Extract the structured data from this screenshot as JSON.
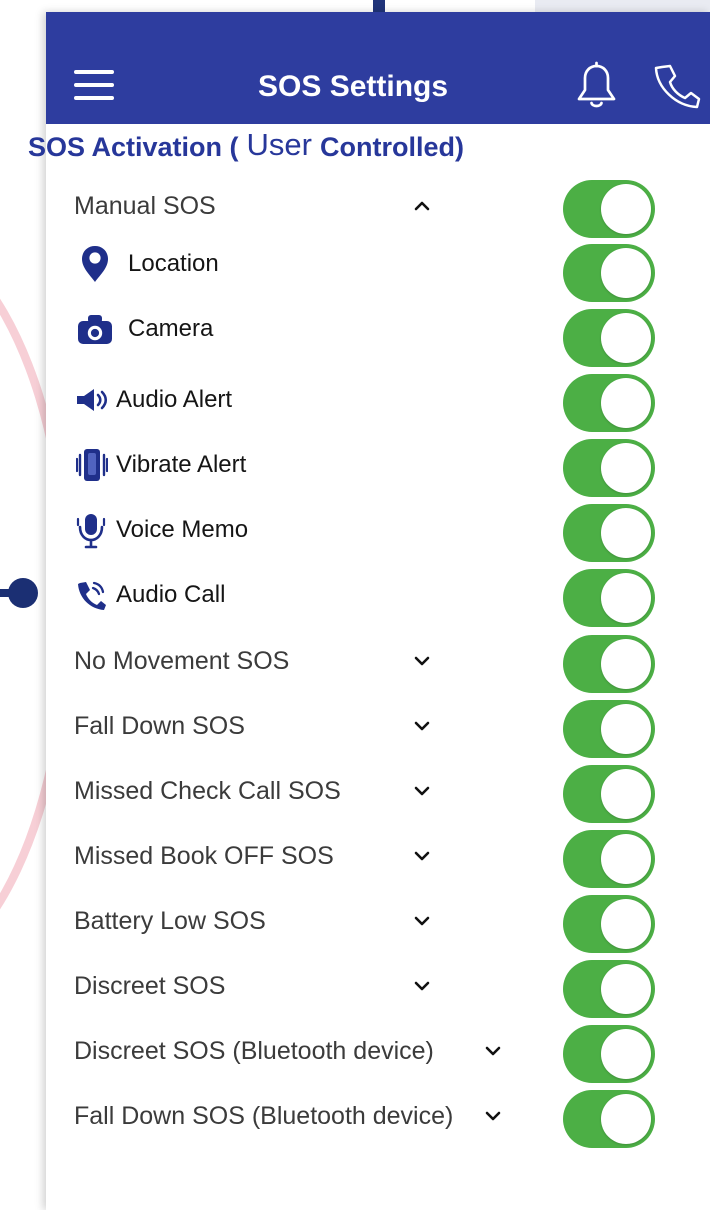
{
  "header": {
    "title": "SOS Settings",
    "menu_icon": "hamburger-menu-icon",
    "notification_icon": "bell-icon",
    "call_icon": "phone-icon"
  },
  "section": {
    "title_prefix": "SOS Activation (",
    "title_user": "User",
    "title_suffix": "Controlled)"
  },
  "settings": [
    {
      "label": "Manual SOS",
      "chevron": "up",
      "enabled": true
    },
    {
      "label": "Location",
      "icon": "location-pin-icon",
      "enabled": true
    },
    {
      "label": "Camera",
      "icon": "camera-icon",
      "enabled": true
    },
    {
      "label": "Audio Alert",
      "icon": "speaker-icon",
      "enabled": true
    },
    {
      "label": "Vibrate Alert",
      "icon": "vibrate-icon",
      "enabled": true
    },
    {
      "label": "Voice Memo",
      "icon": "microphone-icon",
      "enabled": true
    },
    {
      "label": "Audio Call",
      "icon": "phone-call-icon",
      "enabled": true
    },
    {
      "label": "No Movement SOS",
      "chevron": "down",
      "enabled": true
    },
    {
      "label": "Fall Down SOS",
      "chevron": "down",
      "enabled": true
    },
    {
      "label": "Missed Check Call SOS",
      "chevron": "down",
      "enabled": true
    },
    {
      "label": "Missed Book OFF SOS",
      "chevron": "down",
      "enabled": true
    },
    {
      "label": "Battery Low SOS",
      "chevron": "down",
      "enabled": true
    },
    {
      "label": "Discreet SOS",
      "chevron": "down",
      "enabled": true
    },
    {
      "label": "Discreet SOS (Bluetooth device)",
      "chevron": "down",
      "enabled": true
    },
    {
      "label": "Fall Down SOS (Bluetooth device)",
      "chevron": "down",
      "enabled": true
    }
  ],
  "colors": {
    "header_bg": "#2e3d9f",
    "heading_text": "#27379a",
    "toggle_on": "#4caf45",
    "icon": "#1f2f8a"
  }
}
